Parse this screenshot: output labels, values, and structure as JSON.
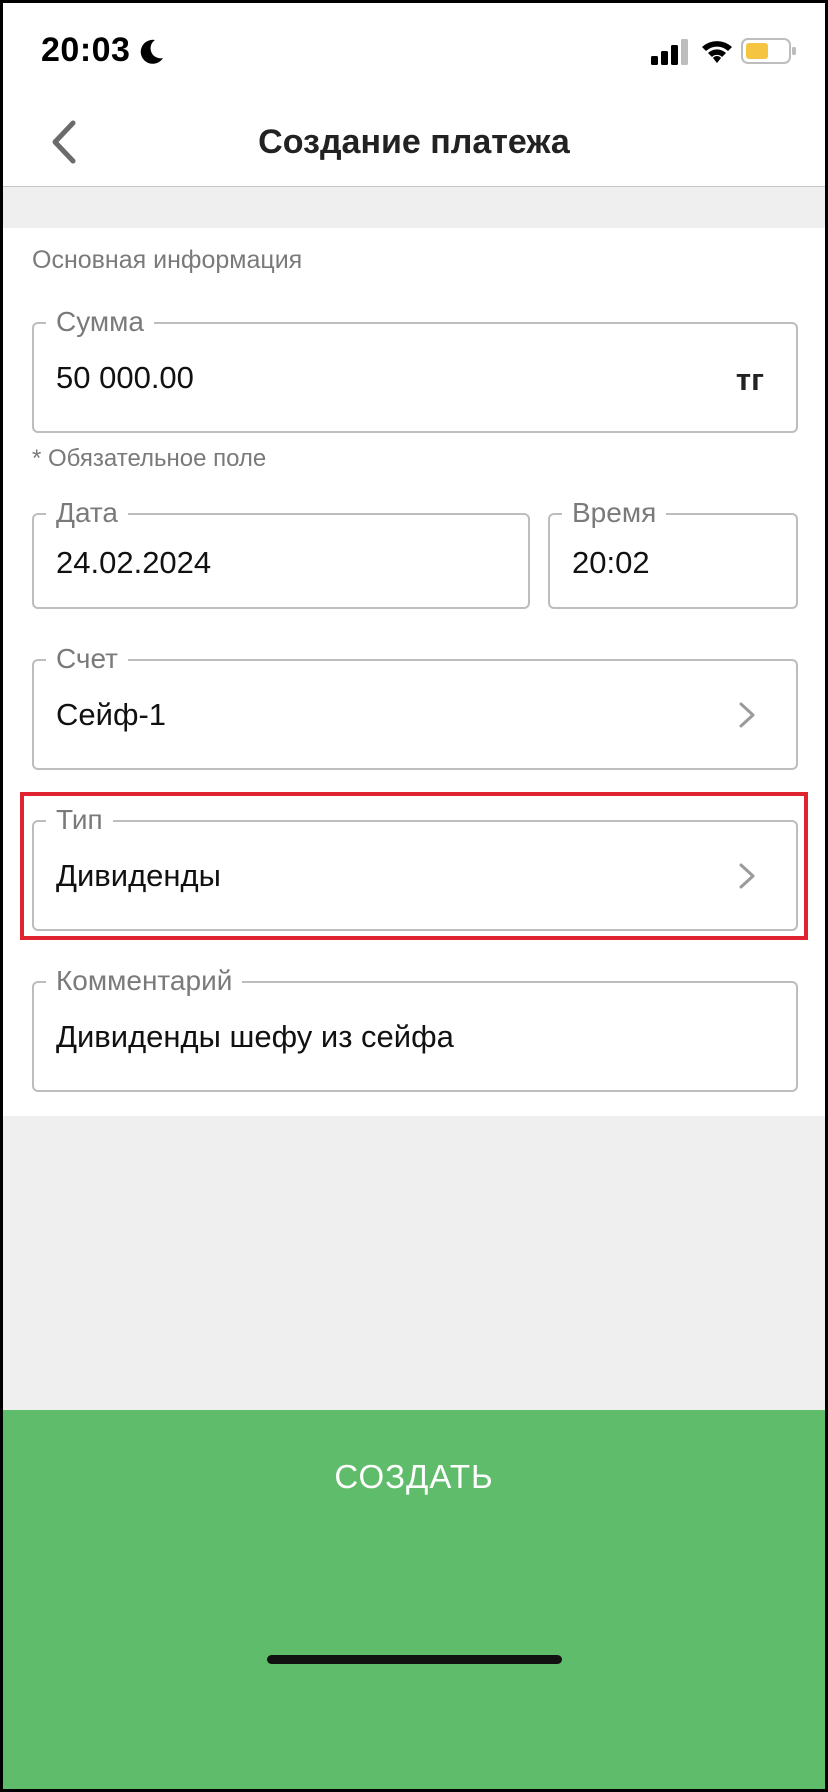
{
  "status_bar": {
    "time": "20:03",
    "icons": [
      "moon-icon",
      "signal-icon",
      "wifi-icon",
      "battery-icon"
    ],
    "battery_color": "#f5c542"
  },
  "nav": {
    "title": "Создание платежа",
    "back_icon": "chevron-left-icon"
  },
  "form": {
    "section_title": "Основная информация",
    "amount": {
      "label": "Сумма",
      "value": "50 000.00",
      "suffix": "тг"
    },
    "required_hint": "* Обязательное поле",
    "date": {
      "label": "Дата",
      "value": "24.02.2024"
    },
    "time": {
      "label": "Время",
      "value": "20:02"
    },
    "account": {
      "label": "Счет",
      "value": "Сейф-1"
    },
    "type": {
      "label": "Тип",
      "value": "Дивиденды"
    },
    "comment": {
      "label": "Комментарий",
      "value": "Дивиденды шефу из сейфа"
    }
  },
  "actions": {
    "create_label": "СОЗДАТЬ"
  },
  "colors": {
    "accent_green": "#5fbc6a",
    "highlight_red": "#e0242f",
    "background": "#efefef"
  }
}
